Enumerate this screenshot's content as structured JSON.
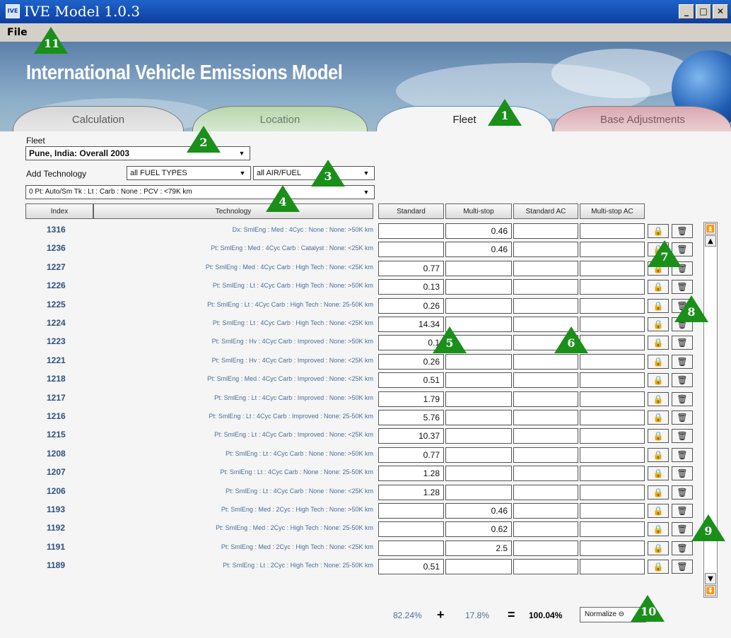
{
  "window": {
    "title": "IVE Model 1.0.3",
    "app_icon_text": "IVE",
    "minimize": "_",
    "maximize": "□",
    "close": "✕"
  },
  "menu": {
    "file": "File"
  },
  "banner": {
    "title": "International Vehicle Emissions Model"
  },
  "tabs": [
    {
      "label": "Calculation",
      "active": false
    },
    {
      "label": "Location",
      "active": false
    },
    {
      "label": "Fleet",
      "active": true
    },
    {
      "label": "Base Adjustments",
      "active": false
    }
  ],
  "fleet": {
    "label": "Fleet",
    "selected": "Pune, India: Overall 2003",
    "add_technology_label": "Add Technology",
    "fuel_filter": "all FUEL TYPES",
    "air_fuel_filter": "all AIR/FUEL",
    "technology_selected": "0   Pt: Auto/Sm Tk : Lt : Carb : None : PCV : <79K km"
  },
  "table": {
    "headers": [
      "Index",
      "Technology",
      "Standard",
      "Multi-stop",
      "Standard AC",
      "Multi-stop AC"
    ],
    "lock_icon": "lock-icon",
    "delete_icon": "trash-icon",
    "rows": [
      {
        "index": "1316",
        "technology": "Dx: SmlEng : Med : 4Cyc : None : None: >50K km",
        "standard": "",
        "multistop": "0.46",
        "standard_ac": "",
        "multistop_ac": ""
      },
      {
        "index": "1236",
        "technology": "Pt: SmlEng : Med : 4Cyc Carb : Catalyst : None: <25K km",
        "standard": "",
        "multistop": "0.46",
        "standard_ac": "",
        "multistop_ac": ""
      },
      {
        "index": "1227",
        "technology": "Pt: SmlEng : Med : 4Cyc Carb : High Tech : None: <25K km",
        "standard": "0.77",
        "multistop": "",
        "standard_ac": "",
        "multistop_ac": ""
      },
      {
        "index": "1226",
        "technology": "Pt: SmlEng : Lt : 4Cyc Carb : High Tech : None: >50K km",
        "standard": "0.13",
        "multistop": "",
        "standard_ac": "",
        "multistop_ac": ""
      },
      {
        "index": "1225",
        "technology": "Pt: SmlEng : Lt : 4Cyc Carb : High Tech : None: 25-50K km",
        "standard": "0.26",
        "multistop": "",
        "standard_ac": "",
        "multistop_ac": ""
      },
      {
        "index": "1224",
        "technology": "Pt: SmlEng : Lt : 4Cyc Carb : High Tech : None: <25K km",
        "standard": "14.34",
        "multistop": "",
        "standard_ac": "",
        "multistop_ac": ""
      },
      {
        "index": "1223",
        "technology": "Pt: SmlEng : Hv : 4Cyc Carb : Improved : None: >50K km",
        "standard": "0.1",
        "multistop": "",
        "standard_ac": "",
        "multistop_ac": ""
      },
      {
        "index": "1221",
        "technology": "Pt: SmlEng : Hv : 4Cyc Carb : Improved : None: <25K km",
        "standard": "0.26",
        "multistop": "",
        "standard_ac": "",
        "multistop_ac": ""
      },
      {
        "index": "1218",
        "technology": "Pt: SmlEng : Med : 4Cyc Carb : Improved : None: <25K km",
        "standard": "0.51",
        "multistop": "",
        "standard_ac": "",
        "multistop_ac": ""
      },
      {
        "index": "1217",
        "technology": "Pt: SmlEng : Lt : 4Cyc Carb : Improved : None: >50K km",
        "standard": "1.79",
        "multistop": "",
        "standard_ac": "",
        "multistop_ac": ""
      },
      {
        "index": "1216",
        "technology": "Pt: SmlEng : Lt : 4Cyc Carb : Improved : None: 25-50K km",
        "standard": "5.76",
        "multistop": "",
        "standard_ac": "",
        "multistop_ac": ""
      },
      {
        "index": "1215",
        "technology": "Pt: SmlEng : Lt : 4Cyc Carb : Improved : None: <25K km",
        "standard": "10.37",
        "multistop": "",
        "standard_ac": "",
        "multistop_ac": ""
      },
      {
        "index": "1208",
        "technology": "Pt: SmlEng : Lt : 4Cyc Carb : None : None: >50K km",
        "standard": "0.77",
        "multistop": "",
        "standard_ac": "",
        "multistop_ac": ""
      },
      {
        "index": "1207",
        "technology": "Pt: SmlEng : Lt : 4Cyc Carb : None : None: 25-50K km",
        "standard": "1.28",
        "multistop": "",
        "standard_ac": "",
        "multistop_ac": ""
      },
      {
        "index": "1206",
        "technology": "Pt: SmlEng : Lt : 4Cyc Carb : None : None: <25K km",
        "standard": "1.28",
        "multistop": "",
        "standard_ac": "",
        "multistop_ac": ""
      },
      {
        "index": "1193",
        "technology": "Pt: SmlEng : Med : 2Cyc : High Tech : None: >50K km",
        "standard": "",
        "multistop": "0.46",
        "standard_ac": "",
        "multistop_ac": ""
      },
      {
        "index": "1192",
        "technology": "Pt: SmlEng : Med : 2Cyc : High Tech : None: 25-50K km",
        "standard": "",
        "multistop": "0.62",
        "standard_ac": "",
        "multistop_ac": ""
      },
      {
        "index": "1191",
        "technology": "Pt: SmlEng : Med : 2Cyc : High Tech : None: <25K km",
        "standard": "",
        "multistop": "2.5",
        "standard_ac": "",
        "multistop_ac": ""
      },
      {
        "index": "1189",
        "technology": "Pt: SmlEng : Lt : 2Cyc : High Tech : None: 25-50K km",
        "standard": "0.51",
        "multistop": "",
        "standard_ac": "",
        "multistop_ac": ""
      }
    ]
  },
  "totals": {
    "standard_pct": "82.24%",
    "plus": "+",
    "multistop_pct": "17.8%",
    "equals": "=",
    "total_pct": "100.04%",
    "normalize_label": "Normalize ⊖"
  },
  "scrollbar": {
    "top": "⏫",
    "up": "▲",
    "down": "▼",
    "bottom": "⏬"
  },
  "callouts": [
    "1",
    "2",
    "3",
    "4",
    "5",
    "6",
    "7",
    "8",
    "9",
    "10",
    "11"
  ],
  "colors": {
    "callout": "#1a8f1a",
    "index_text": "#2f4f82",
    "tech_text": "#4c6d9c"
  }
}
